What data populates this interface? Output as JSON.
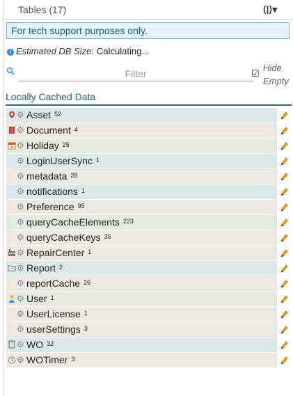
{
  "header": {
    "title": "Tables (17)",
    "menu_glyph": "⟨|⟩▾"
  },
  "notice": "For tech support purposes only.",
  "db_size": {
    "label": "Estimated DB Size:",
    "value": "Calculating..."
  },
  "filter": {
    "placeholder": "Filter",
    "hide_empty_label": "Hide Empty",
    "hide_empty_checked": true
  },
  "section_title": "Locally Cached Data",
  "tables": [
    {
      "name": "Asset",
      "count": "52",
      "icon": "asset-icon",
      "row_color": "blue"
    },
    {
      "name": "Document",
      "count": "4",
      "icon": "document-icon",
      "row_color": "tan"
    },
    {
      "name": "Holiday",
      "count": "25",
      "icon": "holiday-icon",
      "row_color": "green"
    },
    {
      "name": "LoginUserSync",
      "count": "1",
      "icon": "",
      "row_color": "blue"
    },
    {
      "name": "metadata",
      "count": "28",
      "icon": "",
      "row_color": "tan"
    },
    {
      "name": "notifications",
      "count": "1",
      "icon": "",
      "row_color": "blue"
    },
    {
      "name": "Preference",
      "count": "95",
      "icon": "",
      "row_color": "tan"
    },
    {
      "name": "queryCacheElements",
      "count": "223",
      "icon": "",
      "row_color": "green"
    },
    {
      "name": "queryCacheKeys",
      "count": "35",
      "icon": "",
      "row_color": "tan"
    },
    {
      "name": "RepairCenter",
      "count": "1",
      "icon": "repair-center-icon",
      "row_color": "tan"
    },
    {
      "name": "Report",
      "count": "2",
      "icon": "report-icon",
      "row_color": "blue"
    },
    {
      "name": "reportCache",
      "count": "26",
      "icon": "",
      "row_color": "tan"
    },
    {
      "name": "User",
      "count": "1",
      "icon": "user-icon",
      "row_color": "green"
    },
    {
      "name": "UserLicense",
      "count": "1",
      "icon": "",
      "row_color": "tan"
    },
    {
      "name": "userSettings",
      "count": "3",
      "icon": "",
      "row_color": "tan"
    },
    {
      "name": "WO",
      "count": "32",
      "icon": "work-order-icon",
      "row_color": "blue"
    },
    {
      "name": "WOTimer",
      "count": "3",
      "icon": "timer-icon",
      "row_color": "tan"
    }
  ]
}
